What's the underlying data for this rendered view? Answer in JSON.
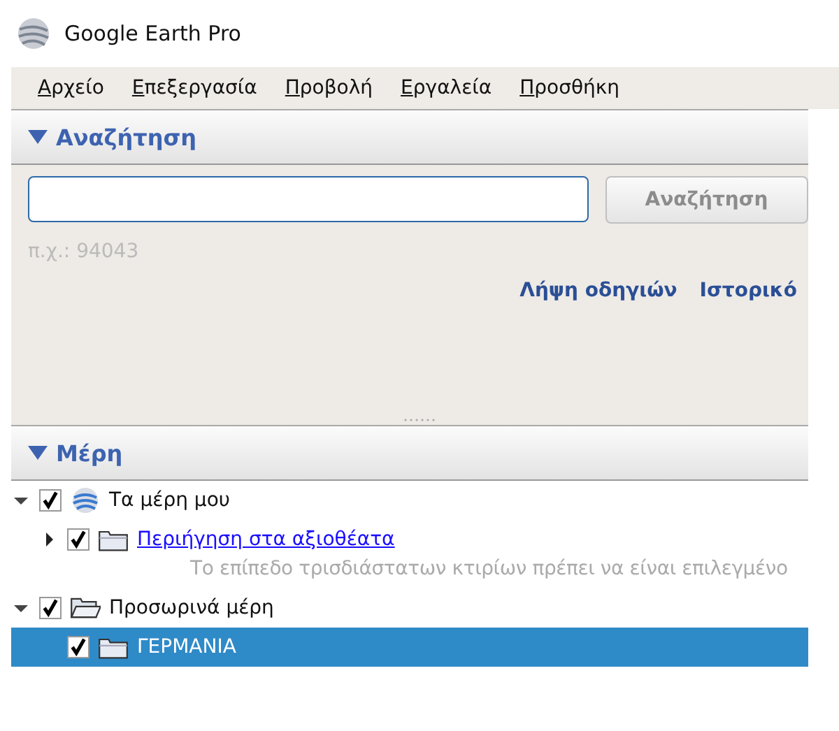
{
  "window": {
    "title": "Google Earth Pro"
  },
  "menu": [
    "Αρχείο",
    "Επεξεργασία",
    "Προβολή",
    "Εργαλεία",
    "Προσθήκη"
  ],
  "search_panel": {
    "header": "Αναζήτηση",
    "expanded": true,
    "button": {
      "label": "Αναζήτηση",
      "disabled": true
    },
    "example": "π.χ.: 94043",
    "links": [
      "Λήψη οδηγιών",
      "Ιστορικό"
    ]
  },
  "places_panel": {
    "header": "Μέρη",
    "expanded": true,
    "tree": [
      {
        "label": "Τα μέρη μου",
        "kind": "globe",
        "checked": true,
        "expanded": true,
        "selected": false,
        "children": [
          {
            "label": "Περιήγηση στα αξιοθέατα",
            "kind": "folder",
            "link": true,
            "checked": true,
            "expanded": false,
            "selected": false,
            "description": "Το επίπεδο τρισδιάστατων κτιρίων πρέπει να είναι επιλεγμένο"
          }
        ]
      },
      {
        "label": "Προσωρινά μέρη",
        "kind": "folder-open",
        "checked": true,
        "expanded": true,
        "selected": false,
        "children": [
          {
            "label": "ΓΕΡΜΑΝΙΑ",
            "kind": "folder",
            "link": false,
            "checked": true,
            "selected": true
          }
        ]
      }
    ]
  }
}
